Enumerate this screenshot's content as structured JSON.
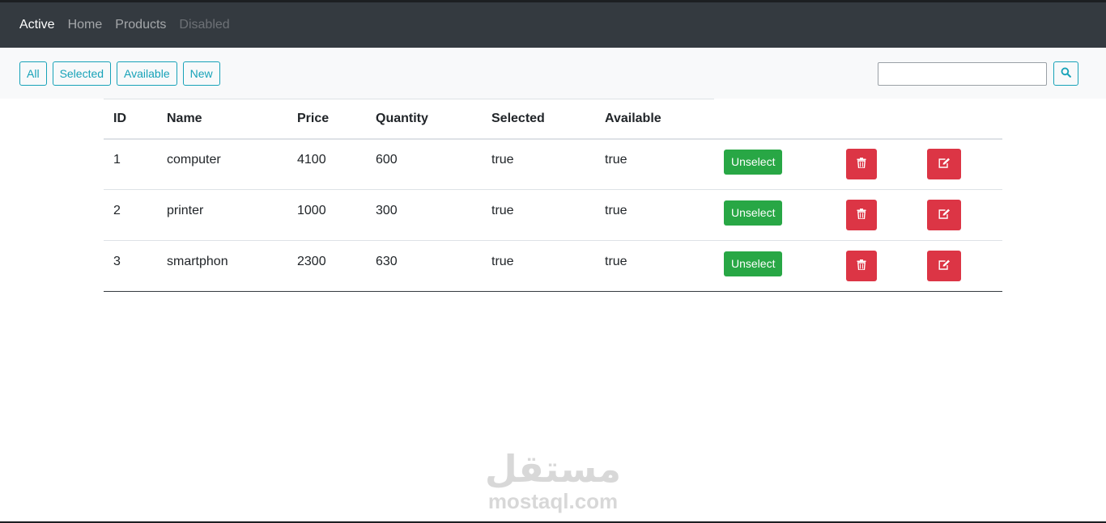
{
  "nav": {
    "items": [
      {
        "label": "Active",
        "state": "active"
      },
      {
        "label": "Home",
        "state": "normal"
      },
      {
        "label": "Products",
        "state": "normal"
      },
      {
        "label": "Disabled",
        "state": "disabled"
      }
    ]
  },
  "toolbar": {
    "filters": [
      "All",
      "Selected",
      "Available",
      "New"
    ],
    "search": {
      "value": "",
      "placeholder": "",
      "icon": "search-icon"
    }
  },
  "table": {
    "columns": [
      "ID",
      "Name",
      "Price",
      "Quantity",
      "Selected",
      "Available"
    ],
    "rows": [
      {
        "id": "1",
        "name": "computer",
        "price": "4100",
        "quantity": "600",
        "selected": "true",
        "available": "true",
        "toggle_label": "Unselect"
      },
      {
        "id": "2",
        "name": "printer",
        "price": "1000",
        "quantity": "300",
        "selected": "true",
        "available": "true",
        "toggle_label": "Unselect"
      },
      {
        "id": "3",
        "name": "smartphon",
        "price": "2300",
        "quantity": "630",
        "selected": "true",
        "available": "true",
        "toggle_label": "Unselect"
      }
    ]
  },
  "watermark": {
    "glyph": "مستقل",
    "text": "mostaql.com"
  },
  "colors": {
    "navbar": "#343a40",
    "info": "#17a2b8",
    "success": "#28a745",
    "danger": "#dc3545"
  }
}
